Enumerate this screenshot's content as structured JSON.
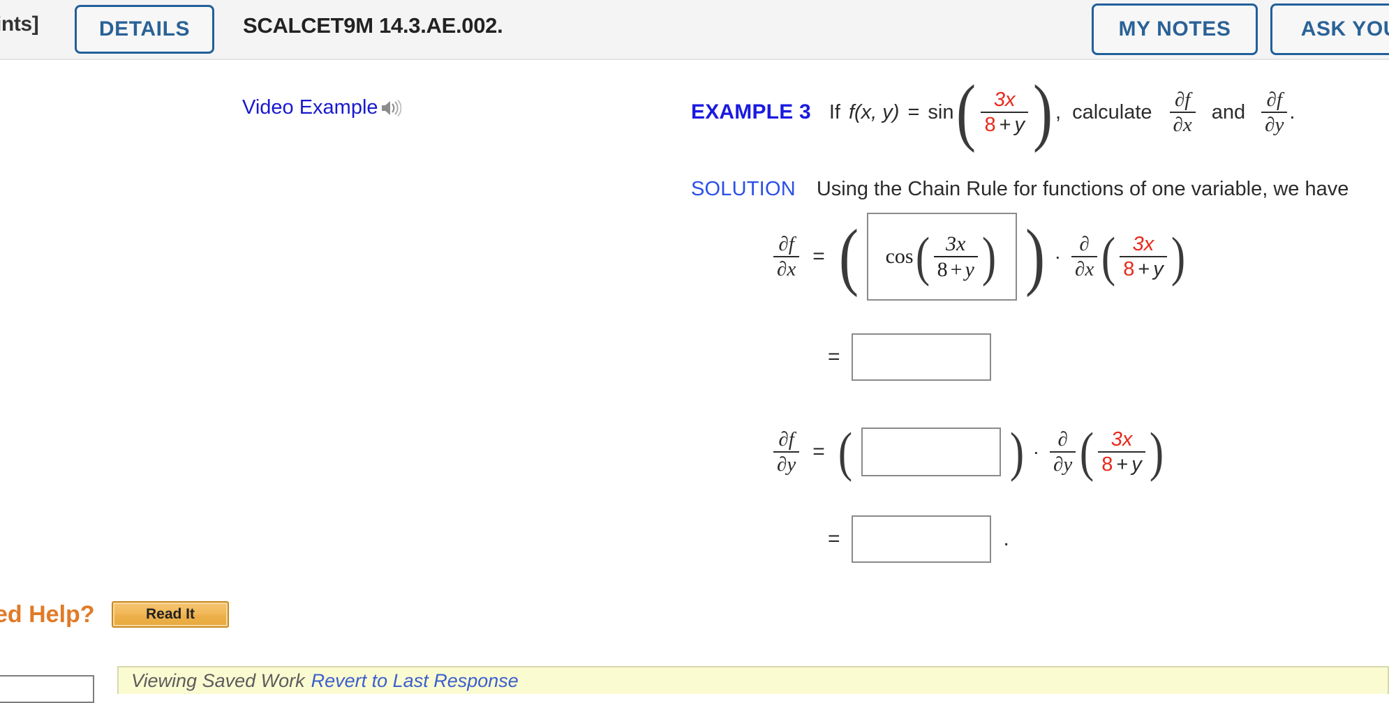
{
  "header": {
    "points_label": "ints]",
    "details_button": "DETAILS",
    "problem_id": "SCALCET9M 14.3.AE.002.",
    "my_notes_button": "MY NOTES",
    "ask_teacher_button": "ASK YOUR"
  },
  "video": {
    "label": "Video Example",
    "icon": "speaker-icon"
  },
  "example": {
    "label": "EXAMPLE 3",
    "if_text": "If",
    "function_name": "f(x, y)",
    "equals": "=",
    "sin": "sin",
    "numerator": "3x",
    "denominator_num": "8",
    "denominator_plus": "+",
    "denominator_var": "y",
    "comma": ",",
    "calculate": "calculate",
    "partial_f": "∂f",
    "partial_x": "∂x",
    "and": "and",
    "partial_y": "∂y",
    "period": "."
  },
  "solution": {
    "label": "SOLUTION",
    "text": "Using the Chain Rule for functions of one variable, we have"
  },
  "equations": {
    "row1": {
      "lhs_num": "∂f",
      "lhs_den": "∂x",
      "equals": "=",
      "open_paren": "(",
      "answer_filled": "cos(3x/(8 + y))",
      "answer_cos": "cos",
      "answer_num": "3x",
      "answer_den_8": "8",
      "answer_den_plus": "+",
      "answer_den_y": "y",
      "close_paren": ")",
      "dot": "·",
      "deriv_num": "∂",
      "deriv_den": "∂x",
      "inner_num": "3x",
      "inner_den_8": "8",
      "inner_den_plus": "+",
      "inner_den_y": "y"
    },
    "row2": {
      "equals": "=",
      "answer": ""
    },
    "row3": {
      "lhs_num": "∂f",
      "lhs_den": "∂y",
      "equals": "=",
      "open_paren": "(",
      "answer": "",
      "close_paren": ")",
      "dot": "·",
      "deriv_num": "∂",
      "deriv_den": "∂y",
      "inner_num": "3x",
      "inner_den_8": "8",
      "inner_den_plus": "+",
      "inner_den_y": "y"
    },
    "row4": {
      "equals": "=",
      "answer": "",
      "period": "."
    }
  },
  "help": {
    "need_help_label": "ed Help?",
    "read_it_button": "Read It"
  },
  "status": {
    "saved_work_text": "Viewing Saved Work",
    "revert_link": "Revert to Last Response"
  },
  "colors": {
    "accent_blue": "#215f9a",
    "link_blue": "#1818cf",
    "example_blue": "#1a1ae0",
    "math_red": "#e8291c",
    "help_orange": "#e07b28",
    "saved_yellow": "#fbfbd2"
  }
}
